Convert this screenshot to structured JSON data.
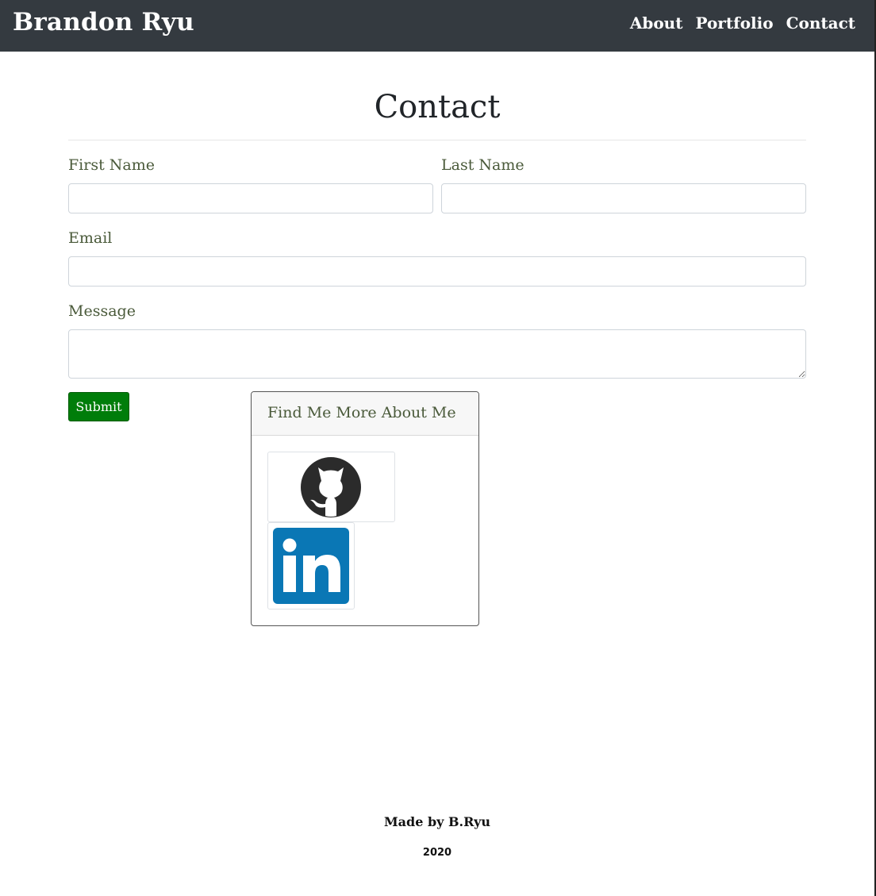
{
  "nav": {
    "brand": "Brandon Ryu",
    "links": [
      {
        "label": "About"
      },
      {
        "label": "Portfolio"
      },
      {
        "label": "Contact"
      }
    ]
  },
  "page": {
    "title": "Contact"
  },
  "form": {
    "first_name": {
      "label": "First Name",
      "value": "",
      "placeholder": ""
    },
    "last_name": {
      "label": "Last Name",
      "value": "",
      "placeholder": ""
    },
    "email": {
      "label": "Email",
      "value": "",
      "placeholder": ""
    },
    "message": {
      "label": "Message",
      "value": "",
      "placeholder": ""
    },
    "submit_label": "Submit"
  },
  "social_card": {
    "title": "Find Me More About Me",
    "links": [
      {
        "icon": "github-icon"
      },
      {
        "icon": "linkedin-icon"
      }
    ]
  },
  "colors": {
    "navbar": "#343a40",
    "submit": "#007d0a",
    "label": "#4a5a3a",
    "linkedin": "#0a77b5"
  },
  "footer": {
    "made_by": "Made by B.Ryu",
    "year": "2020"
  }
}
